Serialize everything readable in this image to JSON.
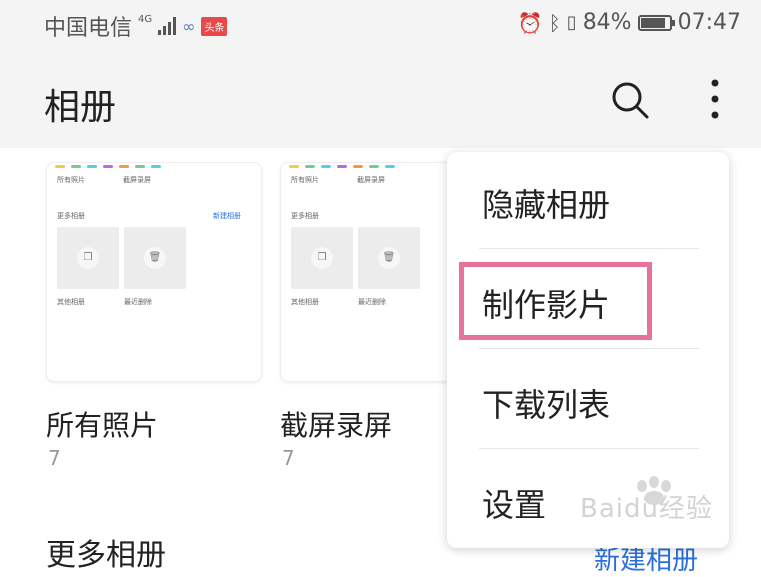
{
  "status_bar": {
    "carrier": "中国电信",
    "network": "4G",
    "news_badge": "头条",
    "battery": "84%",
    "battery_level": 0.84,
    "time": "07:47"
  },
  "app_bar": {
    "title": "相册"
  },
  "albums": [
    {
      "label": "所有照片",
      "count": "7"
    },
    {
      "label": "截屏录屏",
      "count": "7"
    }
  ],
  "thumbnail": {
    "all_photos": "所有照片",
    "screenshots": "截屏录屏",
    "more_albums": "更多相册",
    "new_album": "新建相册",
    "other_albums": "其他相册",
    "recently_deleted": "最近删除"
  },
  "more_albums_section": {
    "title": "更多相册",
    "new_album": "新建相册"
  },
  "menu": {
    "items": [
      "隐藏相册",
      "制作影片",
      "下载列表",
      "设置"
    ],
    "highlighted_item": "制作影片"
  },
  "colors": {
    "highlight_border": "#e8739a",
    "accent_blue": "#2a6fdb"
  },
  "watermark": "Baidu经验"
}
